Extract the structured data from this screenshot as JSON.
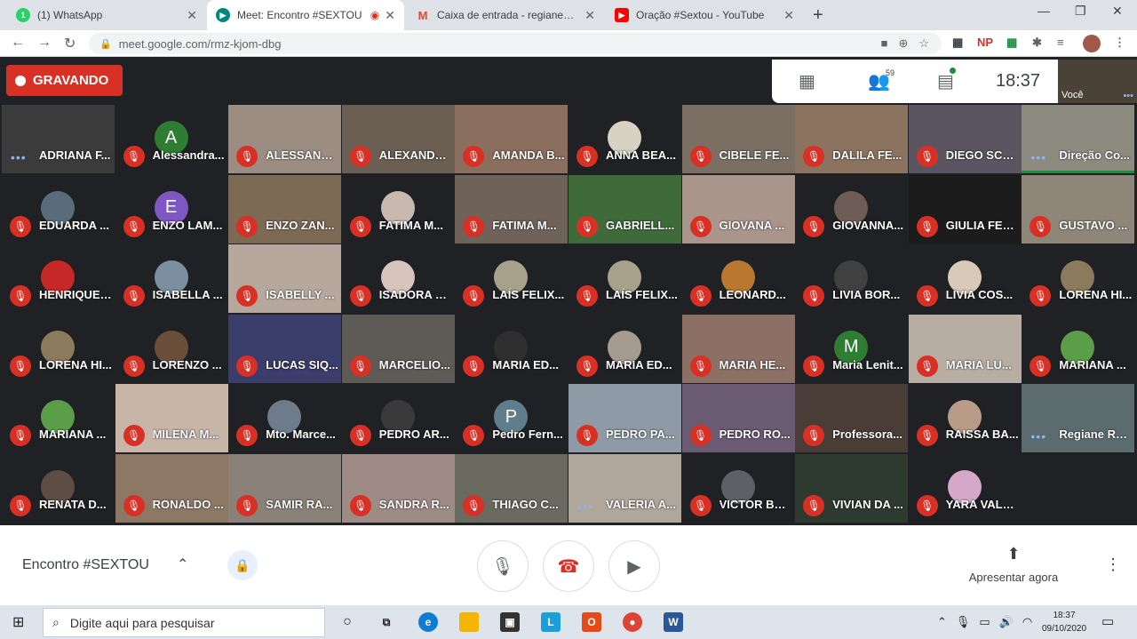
{
  "browser": {
    "tabs": [
      {
        "title": "(1) WhatsApp",
        "icon": "whatsapp-icon",
        "color": "#25d366"
      },
      {
        "title": "Meet: Encontro #SEXTOU",
        "icon": "meet-icon",
        "color": "#00897b"
      },
      {
        "title": "Caixa de entrada - regiane@cole",
        "icon": "gmail-icon",
        "color": "#ea4335"
      },
      {
        "title": "Oração #Sextou - YouTube",
        "icon": "youtube-icon",
        "color": "#ff0000"
      }
    ],
    "url": "meet.google.com/rmz-kjom-dbg",
    "extensions": {
      "np": "NP"
    }
  },
  "meet": {
    "recording_label": "GRAVANDO",
    "participant_count": "59",
    "clock": "18:37",
    "self_label": "Você",
    "meeting_name": "Encontro #SEXTOU",
    "present_label": "Apresentar agora",
    "participants": [
      {
        "name": "ADRIANA F...",
        "muted": false,
        "speaking": true,
        "bg": "#3b3b3b"
      },
      {
        "name": "Alessandra...",
        "muted": true,
        "avatar": "A",
        "avatar_color": "#2e7d32",
        "bg": "#202124"
      },
      {
        "name": "ALESSAND...",
        "muted": true,
        "bg": "#9b8d82"
      },
      {
        "name": "ALEXANDR...",
        "muted": true,
        "bg": "#6b5e52"
      },
      {
        "name": "AMANDA B...",
        "muted": true,
        "bg": "#8a6e5e"
      },
      {
        "name": "ANNA BEA...",
        "muted": true,
        "avatar": "",
        "avatar_color": "#d8d2c4",
        "bg": "#202124"
      },
      {
        "name": "CIBELE FE...",
        "muted": true,
        "bg": "#7a6f62"
      },
      {
        "name": "DALILA FE...",
        "muted": true,
        "bg": "#8b7360"
      },
      {
        "name": "DIEGO SCA...",
        "muted": true,
        "bg": "#5a5560"
      },
      {
        "name": "Direção Co...",
        "muted": false,
        "speaking": true,
        "active": true,
        "bg": "#8d8a80"
      },
      {
        "name": "EDUARDA ...",
        "muted": true,
        "avatar": "",
        "avatar_color": "#5a6c7a",
        "bg": "#202124"
      },
      {
        "name": "ENZO LAM...",
        "muted": true,
        "avatar": "E",
        "avatar_color": "#7e57c2",
        "bg": "#202124"
      },
      {
        "name": "ENZO ZAN...",
        "muted": true,
        "bg": "#7d6a55"
      },
      {
        "name": "FATIMA M...",
        "muted": true,
        "avatar": "",
        "avatar_color": "#c7b9b0",
        "bg": "#202124"
      },
      {
        "name": "FATIMA M...",
        "muted": true,
        "bg": "#6f6259"
      },
      {
        "name": "GABRIELL...",
        "muted": true,
        "bg": "#3f6b3a"
      },
      {
        "name": "GIOVANA ...",
        "muted": true,
        "bg": "#a9958b"
      },
      {
        "name": "GIOVANNA...",
        "muted": true,
        "avatar": "",
        "avatar_color": "#6d5d56",
        "bg": "#202124"
      },
      {
        "name": "GIULIA FER...",
        "muted": true,
        "bg": "#1c1c1c"
      },
      {
        "name": "GUSTAVO ...",
        "muted": true,
        "bg": "#8e8678"
      },
      {
        "name": "HENRIQUE ...",
        "muted": true,
        "avatar": "",
        "avatar_color": "#c62828",
        "bg": "#202124"
      },
      {
        "name": "ISABELLA ...",
        "muted": true,
        "avatar": "",
        "avatar_color": "#7b8fa0",
        "bg": "#202124"
      },
      {
        "name": "ISABELLY ...",
        "muted": true,
        "bg": "#b7a89d"
      },
      {
        "name": "ISADORA D...",
        "muted": true,
        "avatar": "",
        "avatar_color": "#d7c4bd",
        "bg": "#202124"
      },
      {
        "name": "LAÍS FELIX...",
        "muted": true,
        "avatar": "",
        "avatar_color": "#a7a18c",
        "bg": "#202124"
      },
      {
        "name": "LAÍS FELIX...",
        "muted": true,
        "avatar": "",
        "avatar_color": "#a7a18c",
        "bg": "#202124"
      },
      {
        "name": "LEONARD...",
        "muted": true,
        "avatar": "",
        "avatar_color": "#b9782f",
        "bg": "#202124"
      },
      {
        "name": "LIVIA BOR...",
        "muted": true,
        "avatar": "",
        "avatar_color": "#404040",
        "bg": "#202124"
      },
      {
        "name": "LIVIA COS...",
        "muted": true,
        "avatar": "",
        "avatar_color": "#d9c9b8",
        "bg": "#202124"
      },
      {
        "name": "LORENA HI...",
        "muted": true,
        "avatar": "",
        "avatar_color": "#8c7a5c",
        "bg": "#202124"
      },
      {
        "name": "LORENA HI...",
        "muted": true,
        "avatar": "",
        "avatar_color": "#8c7a5c",
        "bg": "#202124"
      },
      {
        "name": "LORENZO ...",
        "muted": true,
        "avatar": "",
        "avatar_color": "#6a4e3a",
        "bg": "#202124"
      },
      {
        "name": "LUCAS SIQ...",
        "muted": true,
        "bg": "#3b3d6b"
      },
      {
        "name": "MARCELIO...",
        "muted": true,
        "bg": "#5e5a55"
      },
      {
        "name": "MARIA ED...",
        "muted": true,
        "avatar": "",
        "avatar_color": "#2f2f2f",
        "bg": "#202124"
      },
      {
        "name": "MARIA ED...",
        "muted": true,
        "avatar": "",
        "avatar_color": "#a69b90",
        "bg": "#202124"
      },
      {
        "name": "MARIA HE...",
        "muted": true,
        "bg": "#8c6f65"
      },
      {
        "name": "Maria Lenit...",
        "muted": true,
        "avatar": "M",
        "avatar_color": "#2e7d32",
        "bg": "#202124"
      },
      {
        "name": "MARIA LU...",
        "muted": true,
        "bg": "#b8ada3"
      },
      {
        "name": "MARIANA ...",
        "muted": true,
        "avatar": "",
        "avatar_color": "#5a9e4a",
        "bg": "#202124"
      },
      {
        "name": "MARIANA ...",
        "muted": true,
        "avatar": "",
        "avatar_color": "#5a9e4a",
        "bg": "#202124"
      },
      {
        "name": "MILENA M...",
        "muted": true,
        "bg": "#c7b5a8"
      },
      {
        "name": "Mto. Marce...",
        "muted": true,
        "avatar": "",
        "avatar_color": "#6d7b8a",
        "bg": "#202124"
      },
      {
        "name": "PEDRO AR...",
        "muted": true,
        "avatar": "",
        "avatar_color": "#3a3a3a",
        "bg": "#202124"
      },
      {
        "name": "Pedro Fern...",
        "muted": true,
        "avatar": "P",
        "avatar_color": "#607d8b",
        "bg": "#202124"
      },
      {
        "name": "PEDRO PA...",
        "muted": true,
        "bg": "#8e9aa5"
      },
      {
        "name": "PEDRO RO...",
        "muted": true,
        "bg": "#6a5a72"
      },
      {
        "name": "Professora...",
        "muted": true,
        "bg": "#4a3d38"
      },
      {
        "name": "RAISSA BA...",
        "muted": true,
        "avatar": "",
        "avatar_color": "#b89c88",
        "bg": "#202124"
      },
      {
        "name": "Regiane Ro...",
        "muted": false,
        "speaking": true,
        "bg": "#5b6b6e"
      },
      {
        "name": "RENATA D...",
        "muted": true,
        "avatar": "",
        "avatar_color": "#5d4d45",
        "bg": "#202124"
      },
      {
        "name": "RONALDO ...",
        "muted": true,
        "bg": "#8d7866"
      },
      {
        "name": "SAMIR RA...",
        "muted": true,
        "bg": "#8a8178"
      },
      {
        "name": "SANDRA R...",
        "muted": true,
        "bg": "#9e8b85"
      },
      {
        "name": "THIAGO C...",
        "muted": true,
        "bg": "#6b6a60"
      },
      {
        "name": "VALERIA A...",
        "muted": false,
        "speaking": true,
        "bg": "#b0a79c"
      },
      {
        "name": "VICTOR BU...",
        "muted": true,
        "avatar": "",
        "avatar_color": "#5d6064",
        "bg": "#202124"
      },
      {
        "name": "VIVIAN DA ...",
        "muted": true,
        "bg": "#2e3a30"
      },
      {
        "name": "YARA VALE...",
        "muted": true,
        "avatar": "",
        "avatar_color": "#d5a8c8",
        "bg": "#202124"
      }
    ]
  },
  "taskbar": {
    "search_placeholder": "Digite aqui para pesquisar",
    "time": "18:37",
    "date": "09/10/2020"
  }
}
